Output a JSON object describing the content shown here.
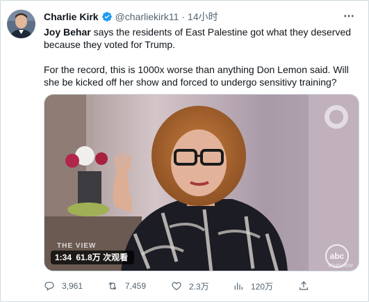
{
  "author": {
    "name": "Charlie Kirk",
    "handle": "@charliekirk11",
    "separator": "·",
    "time": "14小时",
    "verified": true
  },
  "tweet": {
    "mention": "Joy Behar",
    "line1_rest": " says the residents of East Palestine got what they deserved because they voted for Trump.",
    "line2": "For the record, this is 1000x worse than anything Don Lemon said. Will she be kicked off her show and forced to undergo sensitivy training?"
  },
  "video": {
    "duration": "1:34",
    "views": "61.8万 次观看",
    "watermark_left": "THE VIEW",
    "watermark_right": "abc",
    "watermark_right_sub": "#THEVIEW"
  },
  "actions": {
    "replies": "3,961",
    "retweets": "7,459",
    "likes": "2.3万",
    "views": "120万"
  },
  "colors": {
    "text": "#0f1419",
    "secondary": "#536471",
    "verified": "#1d9bf0",
    "border": "#cfd9de"
  }
}
